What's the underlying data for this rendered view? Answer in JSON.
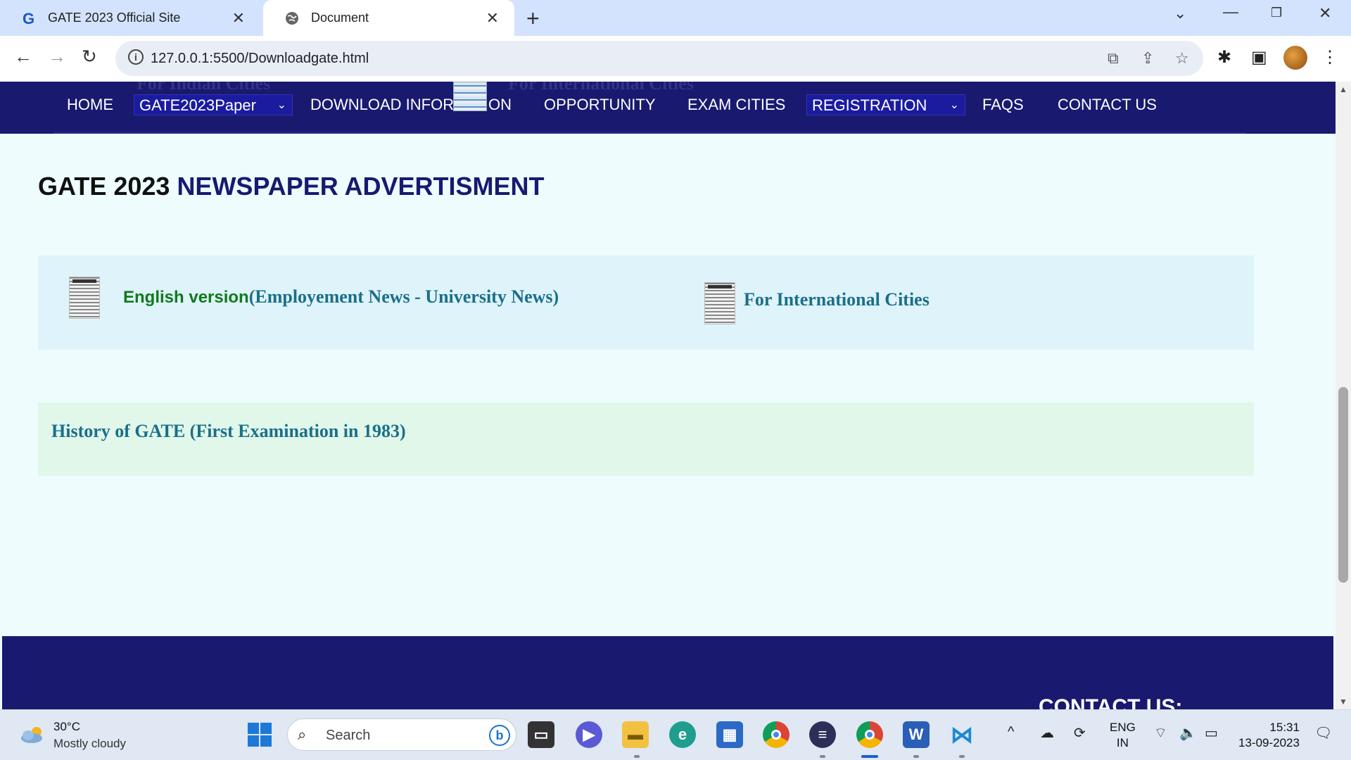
{
  "browser": {
    "tabs": [
      {
        "title": "GATE 2023 Official Site",
        "favicon": "G"
      },
      {
        "title": "Document"
      }
    ],
    "url": "127.0.0.1:5500/Downloadgate.html"
  },
  "page": {
    "navbar": {
      "home": "HOME",
      "paper_select": "GATE2023Paper",
      "download_info_left": "DOWNLOAD INFOR",
      "download_info_right": "ON",
      "opportunity": "OPPORTUNITY",
      "exam_cities": "EXAM CITIES",
      "registration_select": "REGISTRATION",
      "faqs": "FAQS",
      "contact": "CONTACT US",
      "ghost_left": "For Indian Cities",
      "ghost_right": "For International Cities"
    },
    "heading": {
      "part1": "GATE 2023",
      "part2": "NEWSPAPER ADVERTISMENT"
    },
    "advertisement": {
      "english_label": "English version",
      "english_link": "(Employement News - University News)",
      "international_link": "For International Cities"
    },
    "history": "History of GATE (First Examination in 1983)",
    "footer": {
      "contact_title": "CONTACT US:"
    }
  },
  "taskbar": {
    "weather": {
      "temp": "30°C",
      "desc": "Mostly cloudy"
    },
    "search_placeholder": "Search",
    "lang_line1": "ENG",
    "lang_line2": "IN",
    "time": "15:31",
    "date": "13-09-2023"
  }
}
